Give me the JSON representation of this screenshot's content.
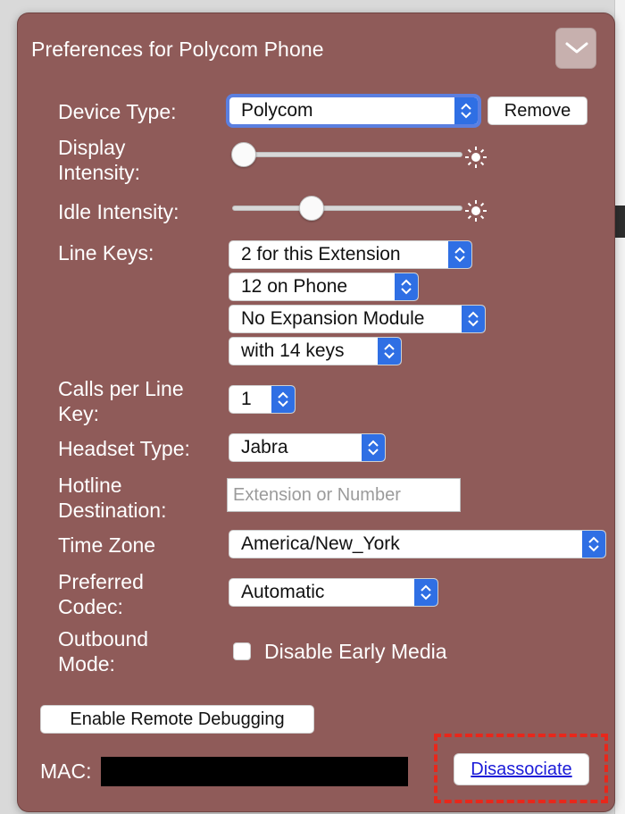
{
  "panel": {
    "title": "Preferences for Polycom Phone",
    "collapse_icon": "chevron-down-icon",
    "background_color": "#8f5b59"
  },
  "fields": {
    "device_type": {
      "label": "Device Type:",
      "value": "Polycom",
      "remove_label": "Remove"
    },
    "display_intensity": {
      "label_line1": "Display",
      "label_line2": "Intensity:",
      "level": 0.0,
      "icon": "sun-icon"
    },
    "idle_intensity": {
      "label": "Idle Intensity:",
      "level": 0.35,
      "icon": "sun-icon"
    },
    "line_keys": {
      "label": "Line Keys:",
      "per_extension": "2 for this Extension",
      "on_phone": "12 on Phone",
      "expansion_module": "No Expansion Module",
      "keys": "with 14 keys"
    },
    "calls_per_line_key": {
      "label_line1": "Calls per Line",
      "label_line2": "Key:",
      "value": "1"
    },
    "headset_type": {
      "label": "Headset Type:",
      "value": "Jabra"
    },
    "hotline_destination": {
      "label_line1": "Hotline",
      "label_line2": "Destination:",
      "value": "",
      "placeholder": "Extension or Number"
    },
    "time_zone": {
      "label": "Time Zone",
      "value": "America/New_York"
    },
    "preferred_codec": {
      "label_line1": "Preferred",
      "label_line2": "Codec:",
      "value": "Automatic"
    },
    "outbound_mode": {
      "label_line1": "Outbound",
      "label_line2": "Mode:",
      "checkbox_label": "Disable Early Media",
      "checked": false
    }
  },
  "actions": {
    "enable_remote_debugging": "Enable Remote Debugging",
    "disassociate": "Disassociate"
  },
  "mac": {
    "label": "MAC:"
  },
  "colors": {
    "accent_blue": "#2f6fe4",
    "highlight_red": "#e8271b",
    "link_blue": "#1a1ad8"
  }
}
